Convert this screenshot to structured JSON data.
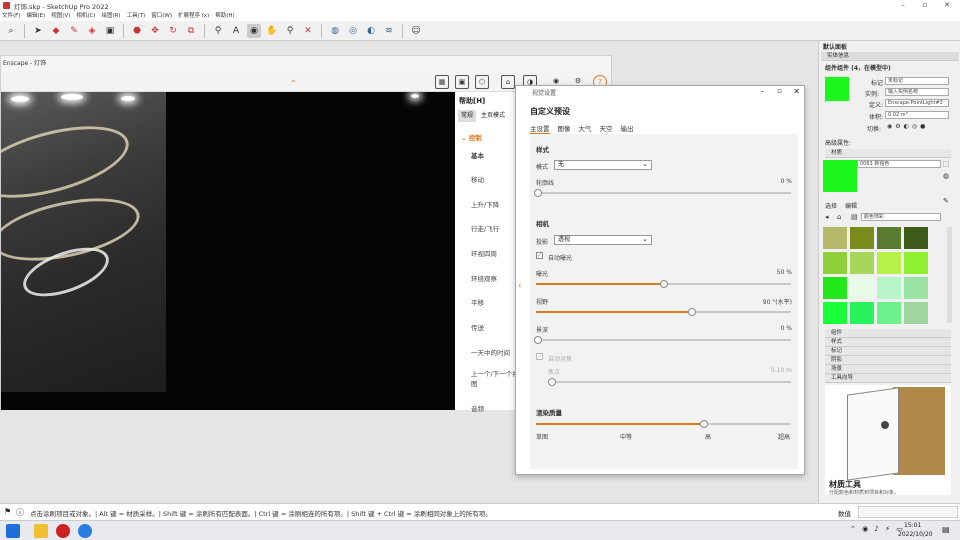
{
  "window": {
    "title": "灯饰.skp - SketchUp Pro 2022"
  },
  "menu": [
    "文件(F)",
    "编辑(E)",
    "视图(V)",
    "相机(C)",
    "绘图(R)",
    "工具(T)",
    "窗口(W)",
    "扩展程序 (x)",
    "帮助(H)"
  ],
  "toolbar_icons": [
    "search-icon",
    "select-icon",
    "eraser-icon",
    "pencil-icon",
    "paint-bucket-icon",
    "rect-icon",
    "push-pull-icon",
    "move-icon",
    "rotate-icon",
    "scale-icon",
    "tape-icon",
    "text-icon",
    "orbit-icon",
    "pan-icon",
    "zoom-icon",
    "zoom-extents-icon",
    "section-icon",
    "3d-warehouse-icon",
    "extension-icon",
    "account-icon"
  ],
  "enscape": {
    "title": "Enscape - 灯饰",
    "help_title": "帮助[H]",
    "help_tabs": [
      "常规",
      "主页模式"
    ],
    "control_label": "控制",
    "help_items": [
      "基本",
      "移动",
      "上升/下降",
      "行走/飞行",
      "环视四周",
      "环绕观察",
      "平移",
      "传送",
      "一天中的时间",
      "上一个/下一个视图",
      "音频"
    ]
  },
  "dialog": {
    "window_title": "视觉设置",
    "heading": "自定义预设",
    "tabs": [
      "主设置",
      "图像",
      "大气",
      "天空",
      "输出"
    ],
    "style_section": "样式",
    "mode_label": "模式",
    "mode_value": "无",
    "outline_label": "轮廓线",
    "outline_value": "0 %",
    "camera_section": "相机",
    "projection_label": "投影",
    "projection_value": "透视",
    "auto_exposure_label": "自动曝光",
    "exposure_label": "曝光",
    "exposure_value": "50 %",
    "fov_label": "视野",
    "fov_value": "90 °(水平)",
    "dof_label": "景深",
    "dof_value": "0 %",
    "autofocus_label": "自动对焦",
    "focus_label": "焦点",
    "focus_value": "0.10 m",
    "quality_section": "渲染质量",
    "quality_levels": [
      "草图",
      "中等",
      "高",
      "超高"
    ],
    "exposure_pct": 50,
    "fov_pct": 61,
    "quality_pct": 66,
    "accent": "#e0781e"
  },
  "tray": {
    "title": "默认面板",
    "entity_info": "实体信息",
    "entity_desc": "组件组件 (4，在模型中)",
    "tag_label": "标记",
    "tag_value": "未标记",
    "instance_label": "实例:",
    "instance_value": "输入实例名称",
    "definition_label": "定义:",
    "definition_value": "Enscape.PointLight#3",
    "area_label": "体积:",
    "area_value": "0.02 m³",
    "toggle_label": "切换:",
    "advanced_label": "高级属性:",
    "materials_section": "材质",
    "material_name": "0063 新铭色",
    "select_tab": "选择",
    "edit_tab": "编辑",
    "library_value": "颜色饰彩",
    "swatches": [
      "#b5b868",
      "#7a8b1c",
      "#5a7a30",
      "#3c5a18",
      "#8fcf3a",
      "#a6d65a",
      "#b8f04a",
      "#8ef030",
      "#22e81a",
      "#e8fae8",
      "#b6f6c8",
      "#9ae3a2",
      "#1aff3a",
      "#2af25a",
      "#6cf08e",
      "#a0d6a0"
    ],
    "sections": [
      "组件",
      "样式",
      "标记",
      "阴影",
      "场景",
      "工具向导"
    ],
    "instructor_title": "材质工具",
    "instructor_desc": "分配颜色和材质到项目和对象。",
    "material_color": "#1cf51c"
  },
  "status": {
    "text": "点击涂刷项目或对象。| Alt 键 = 材质采样。| Shift 键 = 涂刷所有匹配表面。| Ctrl 键 = 涂刷相连的所有项。| Shift 键 + Ctrl 键 = 涂刷相同对象上的所有项。",
    "measure_label": "数值"
  },
  "taskbar": {
    "time": "15:01",
    "date": "2022/10/20"
  }
}
